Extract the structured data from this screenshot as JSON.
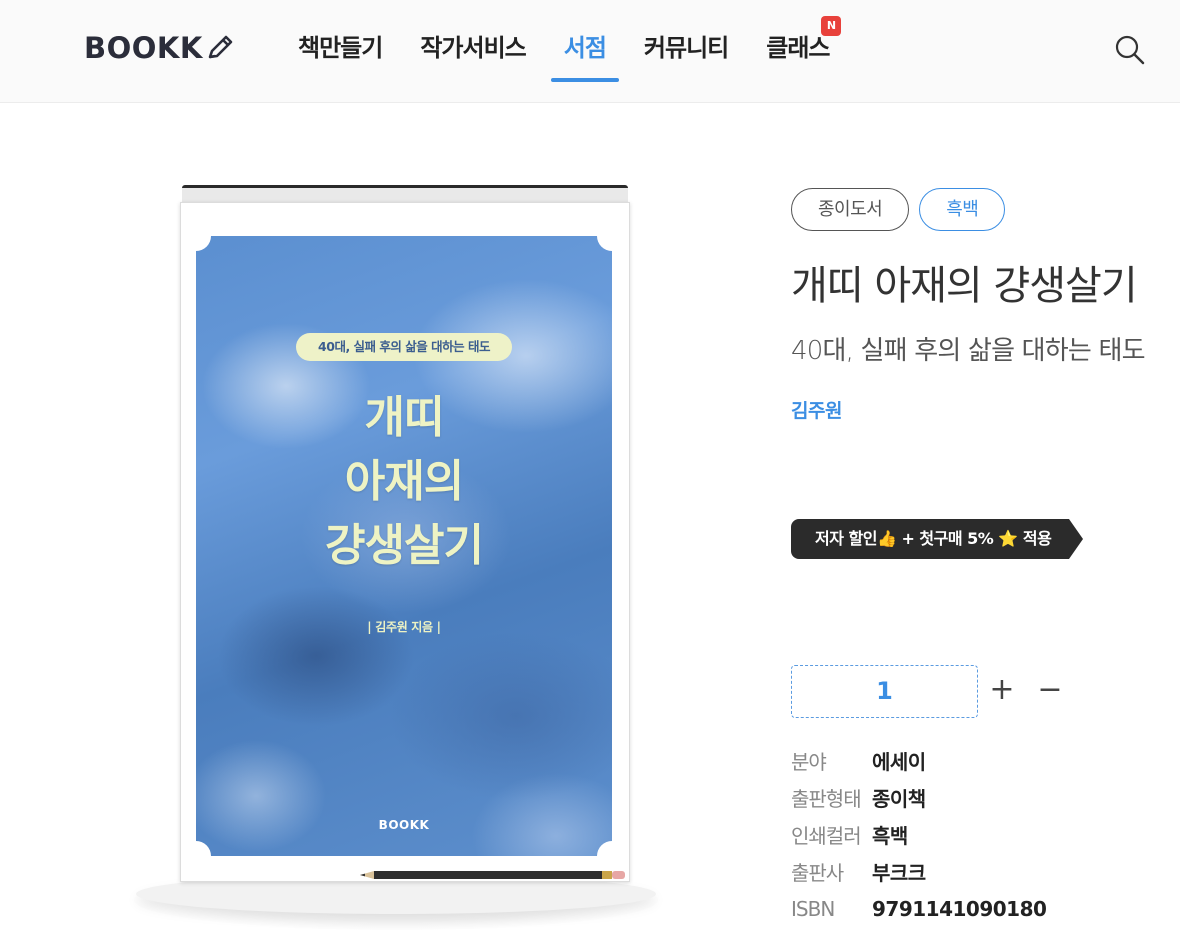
{
  "header": {
    "logo": "BOOKK",
    "nav": [
      {
        "label": "책만들기"
      },
      {
        "label": "작가서비스"
      },
      {
        "label": "서점"
      },
      {
        "label": "커뮤니티"
      },
      {
        "label": "클래스",
        "badge": "N"
      }
    ],
    "active_nav": "서점",
    "search_icon": "search-icon"
  },
  "cover": {
    "tagline": "40대, 실패 후의 삶을 대하는 태도",
    "title_lines": [
      "개띠",
      "아재의",
      "걍생살기"
    ],
    "author_line": "| 김주원 지음 |",
    "brand": "BOOKK"
  },
  "product": {
    "tags": [
      "종이도서",
      "흑백"
    ],
    "title": "개띠 아재의 걍생살기",
    "subtitle": "40대, 실패 후의 삶을 대하는 태도",
    "author": "김주원",
    "discount": "저자 할인👍 + 첫구매 5% ⭐ 적용",
    "quantity": "1",
    "plus": "+",
    "minus": "−",
    "info": [
      {
        "label": "분야",
        "value": "에세이"
      },
      {
        "label": "출판형태",
        "value": "종이책"
      },
      {
        "label": "인쇄컬러",
        "value": "흑백"
      },
      {
        "label": "출판사",
        "value": "부크크"
      },
      {
        "label": "ISBN",
        "value": "9791141090180"
      }
    ]
  },
  "colors": {
    "accent": "#3b8ee3",
    "badge": "#e8413b",
    "discount_bg": "#2b2b2b",
    "cover_text": "#eef3c4"
  }
}
